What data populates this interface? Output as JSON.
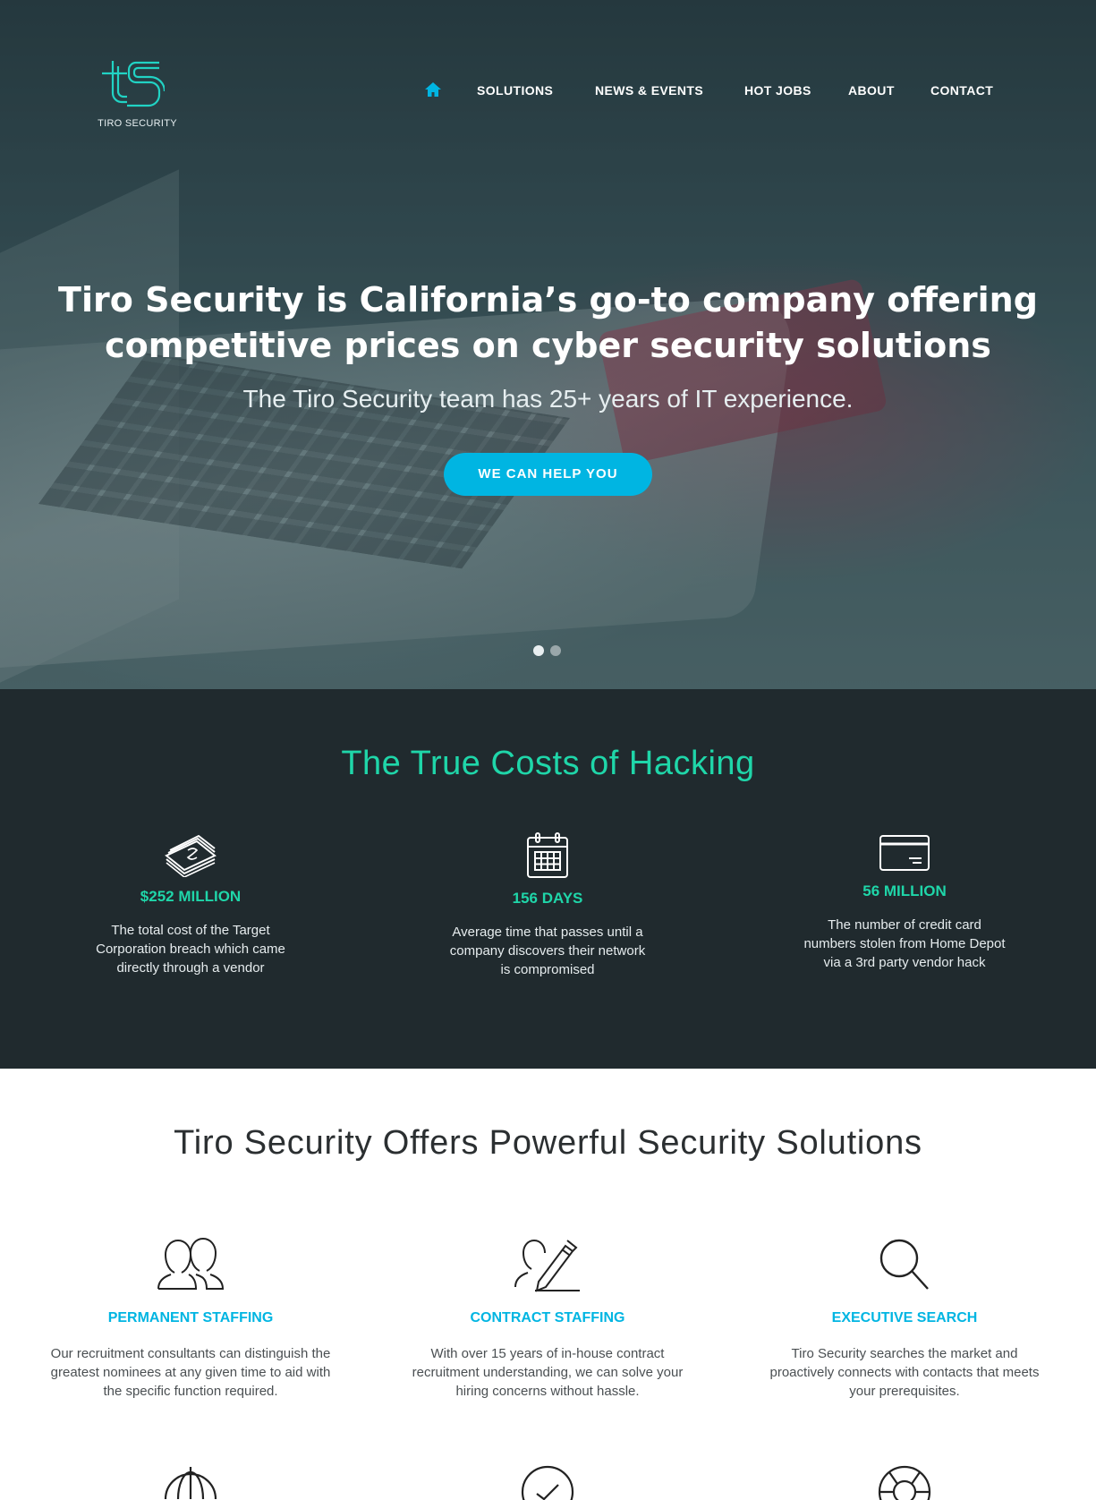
{
  "brand": {
    "name": "TIRO SECURITY",
    "accent": "#00b5e2",
    "green": "#1fd6a9"
  },
  "nav": {
    "home_icon": "home-icon",
    "items": [
      "SOLUTIONS",
      "NEWS & EVENTS",
      "HOT JOBS",
      "ABOUT",
      "CONTACT"
    ]
  },
  "hero": {
    "title_line1": "Tiro Security is California’s go-to company offering",
    "title_line2": "competitive prices on cyber security solutions",
    "subtitle": "The Tiro Security team has 25+ years of IT experience.",
    "cta": "WE CAN HELP YOU",
    "slides": 2,
    "active_slide": 1
  },
  "costs": {
    "title": "The True Costs of Hacking",
    "stats": [
      {
        "icon": "money-stack-icon",
        "value": "$252 MILLION",
        "desc": [
          "The total cost of the Target",
          "Corporation breach which came",
          "directly through a vendor"
        ]
      },
      {
        "icon": "calendar-icon",
        "value": "156 DAYS",
        "desc": [
          "Average time that passes until a",
          "company discovers their network",
          "is compromised"
        ]
      },
      {
        "icon": "credit-card-icon",
        "value": "56 MILLION",
        "desc": [
          "The number of credit card",
          "numbers stolen from Home Depot",
          "via a 3rd party vendor hack"
        ]
      }
    ]
  },
  "solutions": {
    "title": "Tiro Security Offers Powerful Security Solutions",
    "items": [
      {
        "icon": "people-icon",
        "name": "PERMANENT STAFFING",
        "desc": [
          "Our recruitment consultants can distinguish the",
          "greatest nominees at any given time to aid with",
          "the specific function required."
        ]
      },
      {
        "icon": "pen-signature-icon",
        "name": "CONTRACT STAFFING",
        "desc": [
          "With over 15 years of in-house contract",
          "recruitment understanding, we can solve your",
          "hiring concerns without hassle."
        ]
      },
      {
        "icon": "magnifier-icon",
        "name": "EXECUTIVE SEARCH",
        "desc": [
          "Tiro Security searches the market and",
          "proactively connects with contacts that meets",
          "your prerequisites."
        ]
      }
    ],
    "more_icons": [
      "umbrella-icon",
      "checkmark-circle-icon",
      "lifebuoy-icon"
    ]
  }
}
